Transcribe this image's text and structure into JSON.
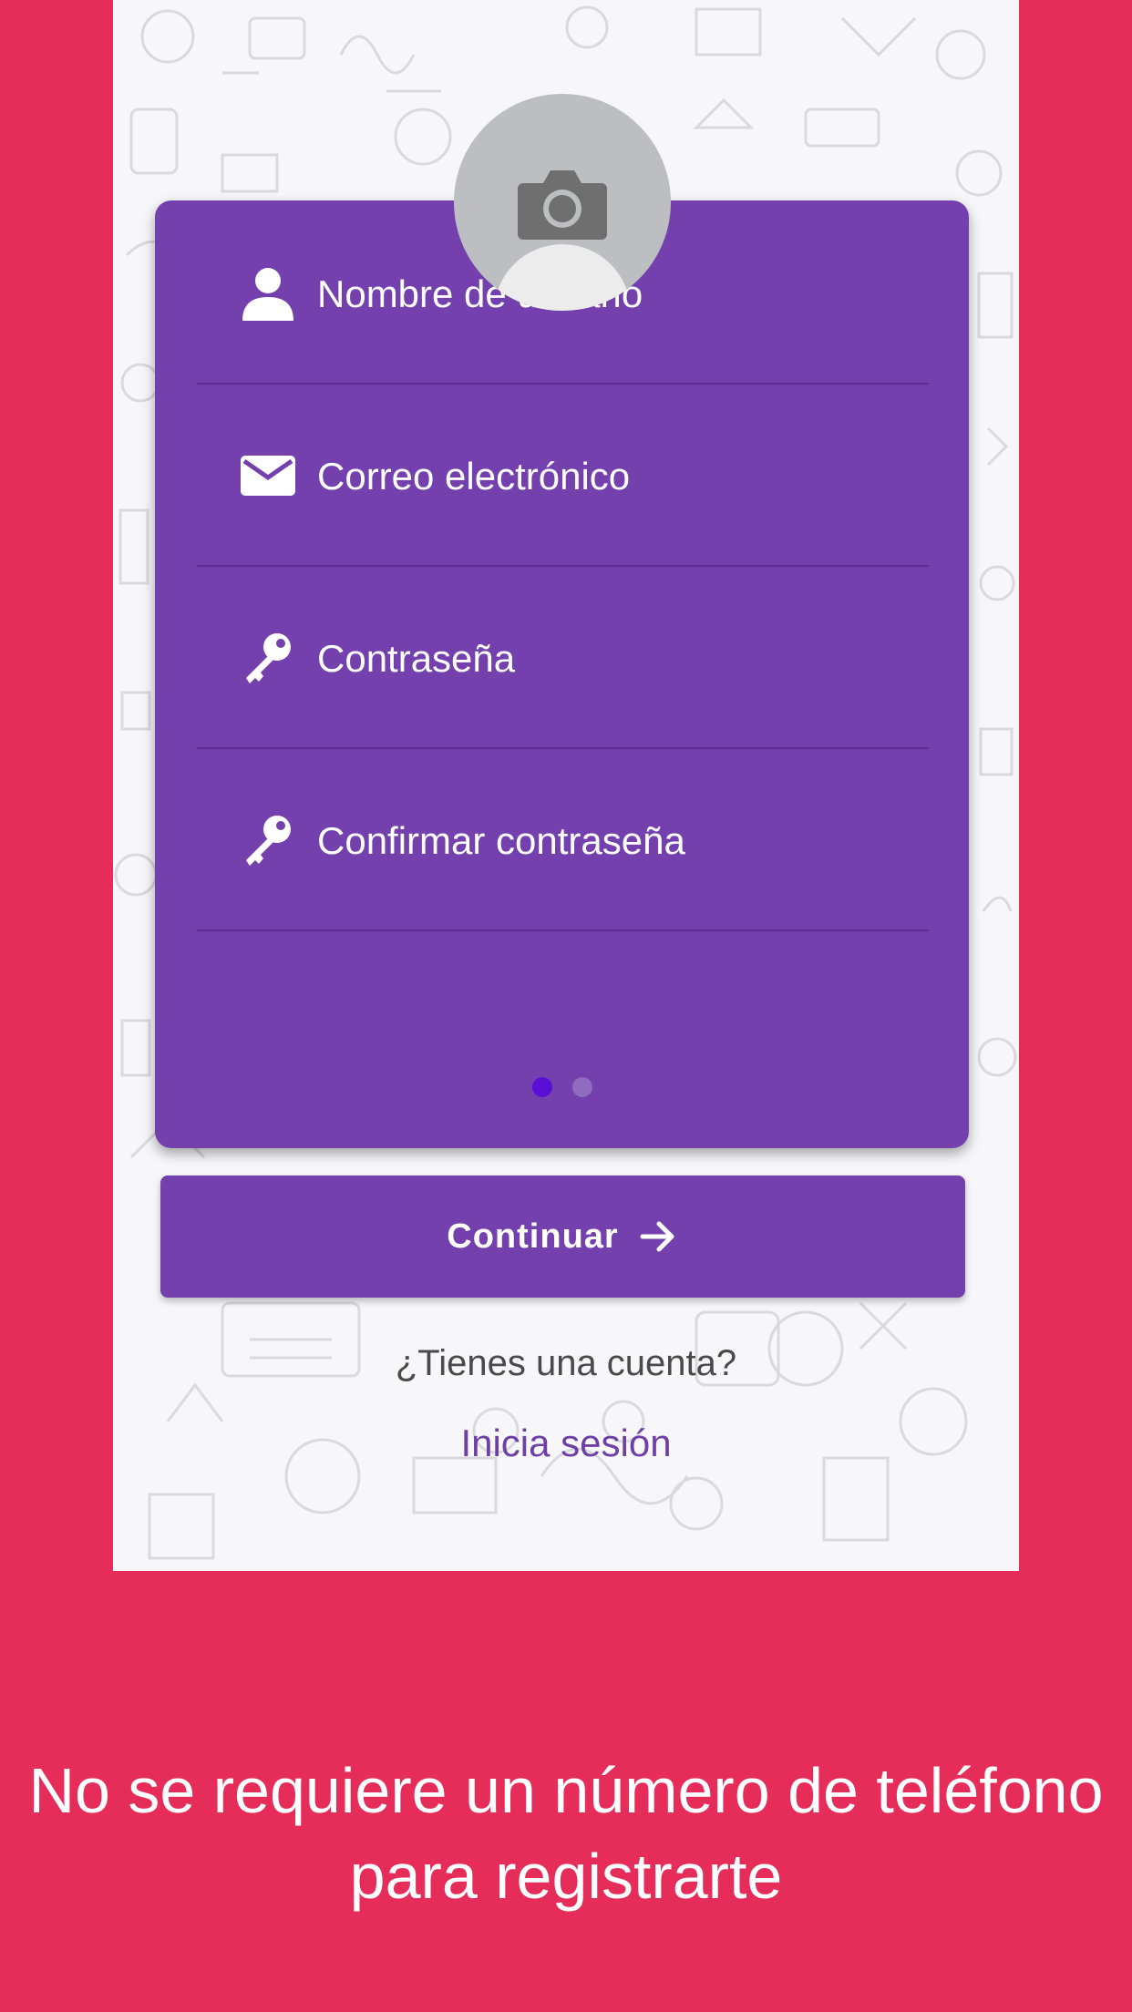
{
  "form": {
    "fields": [
      {
        "label": "Nombre de usuario",
        "icon": "user-icon"
      },
      {
        "label": "Correo electrónico",
        "icon": "envelope-icon"
      },
      {
        "label": "Contraseña",
        "icon": "key-icon"
      },
      {
        "label": "Confirmar contraseña",
        "icon": "key-icon"
      }
    ],
    "pager": {
      "current": 1,
      "total": 2
    }
  },
  "actions": {
    "continue_label": "Continuar",
    "have_account": "¿Tienes una cuenta?",
    "login_link": "Inicia sesión"
  },
  "promo": {
    "tagline": "No se requiere un número de teléfono para registrarte"
  },
  "colors": {
    "background": "#e62d5a",
    "card": "#7340ad",
    "accent": "#5a0fd6"
  }
}
